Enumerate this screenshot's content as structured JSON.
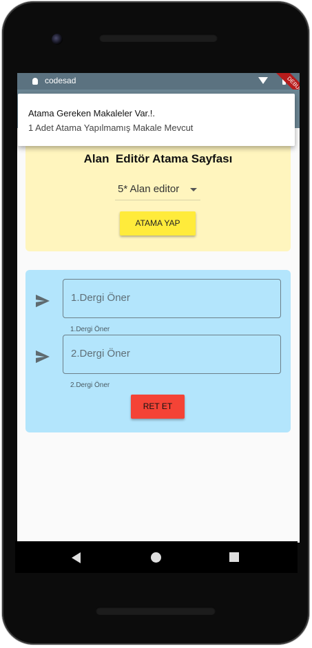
{
  "status_bar": {
    "app_name": "codesad",
    "debug_banner": "DEBUG"
  },
  "notification": {
    "title": "Atama Gereken Makaleler Var.!.",
    "body": "1 Adet Atama Yapılmamış Makale Mevcut"
  },
  "assignment_card": {
    "title": "Alan  Editör Atama Sayfası",
    "editor_dropdown_value": "5* Alan editor",
    "assign_button_label": "ATAMA YAP",
    "color": "#fff5be"
  },
  "journal_card": {
    "color": "#b3e5fc",
    "fields": [
      {
        "placeholder": "1.Dergi Öner",
        "helper": "1.Dergi Öner"
      },
      {
        "placeholder": "2.Dergi Öner",
        "helper": "2.Dergi Öner"
      }
    ],
    "reject_button_label": "RET ET"
  },
  "colors": {
    "assign_button": "#ffeb3b",
    "reject_button": "#f44336",
    "status_bar": "#5b7280",
    "app_bar": "#6b8593"
  },
  "icons": [
    "send-icon",
    "dropdown-arrow-icon",
    "back-icon",
    "home-icon",
    "recents-icon"
  ]
}
